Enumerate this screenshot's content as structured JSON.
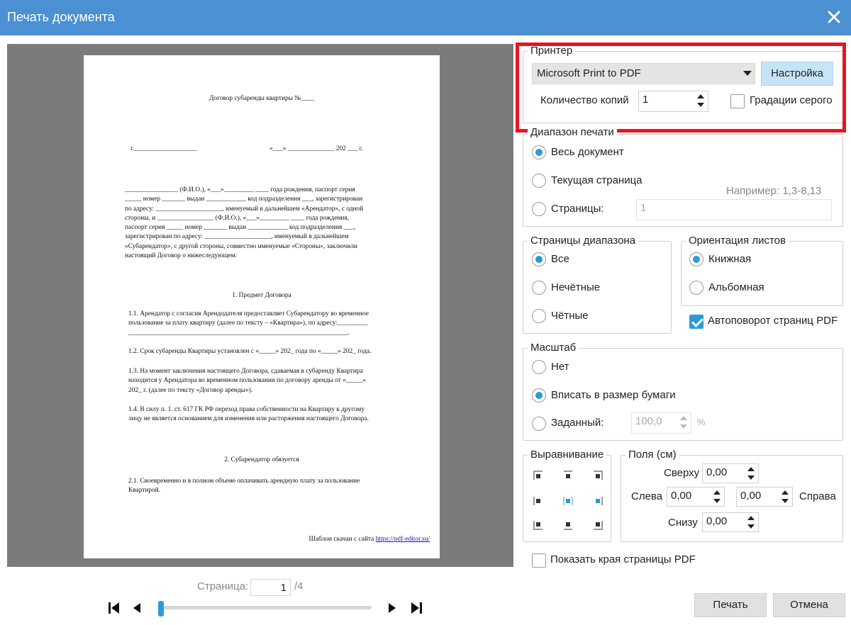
{
  "window": {
    "title": "Печать документа"
  },
  "preview": {
    "doc_title": "Договор субаренды квартиры №____",
    "place_date_left": "г.___________________",
    "place_date_right": "«___» ______________ 202 ___ г.",
    "intro": [
      "________________ (Ф.И.О.), «___»_________ ____ года рождения, паспорт серия",
      "_____ номер _______ выдан ____________ код подразделения ___, зарегистрирован",
      "по адресу: ____________________, именуемый в дальнейшем «Арендатор», с одной",
      "стороны, и _________________ (Ф.И.О.), «___»_________ ____ года рождения,",
      "паспорт серия _____ номер _______ выдан ____________ код подразделения ___,",
      "зарегистрирован по адресу: ____________________, именуемый в дальнейшем",
      "«Субарендатор», с другой стороны, совместно именуемые «Стороны», заключили",
      "настоящий Договор о нижеследующем:"
    ],
    "section1_title": "1. Предмет Договора",
    "p11": [
      "1.1. Арендатор с согласия Арендодателя предоставляет Субарендатору во временное",
      "пользование за плату квартиру (далее по тексту – «Квартира»), по адресу:_________",
      "__________________________________________________________________."
    ],
    "p12": [
      "1.2. Срок субаренды Квартиры установлен с «_____» 202_ года по «_____» 202_ года."
    ],
    "p13": [
      "1.3. На момент заключения настоящего Договора, сдаваемая в субаренду Квартира",
      "находится у Арендатора во временном пользовании по договору аренды от «_____»",
      "202_ г. (далее по тексту «Договор аренды»)."
    ],
    "p14": [
      "1.4. В силу п. 1. ст. 617 ГК РФ переход права собственности на Квартиру к другому",
      "лицу не является основанием для изменения или расторжения настоящего Договора."
    ],
    "section2_title": "2. Субарендатор обязуется",
    "p21": [
      "2.1. Своевременно и в полном объеме оплачивать арендную плату за пользование",
      "Квартирой."
    ],
    "footer_text": "Шаблон скачан с сайта ",
    "footer_link": "https://pdf-editor.su/"
  },
  "pager": {
    "label": "Страница:",
    "current": "1",
    "total": "/4"
  },
  "printer": {
    "legend": "Принтер",
    "name": "Microsoft Print to PDF",
    "settings_button": "Настройка",
    "copies_label": "Количество копий",
    "copies": "1",
    "grayscale_label": "Градации серого",
    "grayscale_checked": false
  },
  "range": {
    "legend": "Диапазон печати",
    "options": [
      "Весь документ",
      "Текущая страница",
      "Страницы:"
    ],
    "selected": 0,
    "example": "Например: 1,3-8,13",
    "pages_value": "1"
  },
  "subset": {
    "legend": "Страницы диапазона",
    "options": [
      "Все",
      "Нечётные",
      "Чётные"
    ],
    "selected": 0
  },
  "orientation": {
    "legend": "Ориентация листов",
    "options": [
      "Книжная",
      "Альбомная"
    ],
    "selected": 0
  },
  "autorotate": {
    "label": "Автоповорот страниц PDF",
    "checked": true
  },
  "scale": {
    "legend": "Масштаб",
    "options": [
      "Нет",
      "Вписать в размер бумаги",
      "Заданный:"
    ],
    "selected": 1,
    "custom_value": "100,0",
    "unit": "%"
  },
  "alignment": {
    "legend": "Выравнивание",
    "selected": "middle-center"
  },
  "margins": {
    "legend": "Поля (см)",
    "top_label": "Сверху",
    "top": "0,00",
    "left_label": "Слева",
    "left": "0,00",
    "right_label": "Справа",
    "right": "0,00",
    "bottom_label": "Снизу",
    "bottom": "0,00"
  },
  "show_edges": {
    "label": "Показать края страницы PDF",
    "checked": false
  },
  "buttons": {
    "print": "Печать",
    "cancel": "Отмена"
  },
  "colors": {
    "titlebar": "#4a90d3",
    "accent": "#2a9bd8",
    "highlight": "#e8141e"
  }
}
